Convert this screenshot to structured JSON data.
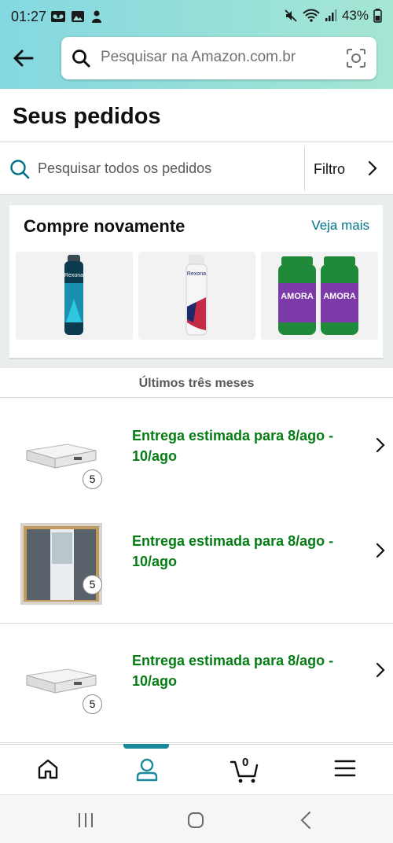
{
  "status_bar": {
    "time": "01:27",
    "battery_percent": "43%",
    "left_icons": [
      "voicemail-icon",
      "gallery-icon",
      "android-icon"
    ],
    "right_icons": [
      "mute-icon",
      "wifi-icon",
      "signal-icon",
      "battery-icon"
    ]
  },
  "header": {
    "search_placeholder": "Pesquisar na Amazon.com.br"
  },
  "page": {
    "title": "Seus pedidos"
  },
  "orders_search": {
    "placeholder": "Pesquisar todos os pedidos",
    "filter_label": "Filtro"
  },
  "buy_again": {
    "title": "Compre novamente",
    "see_more": "Veja mais",
    "items": [
      {
        "name": "rexona-men-deodorant"
      },
      {
        "name": "rexona-women-deodorant"
      },
      {
        "name": "amora-miura-supplement"
      }
    ]
  },
  "orders": {
    "section_label": "Últimos três meses",
    "items": [
      {
        "status": "Entrega estimada para 8/ago - 10/ago",
        "quantity": "5",
        "product": "mattress"
      },
      {
        "status": "Entrega estimada para 8/ago - 10/ago",
        "quantity": "5",
        "product": "wardrobe"
      },
      {
        "status": "Entrega estimada para 8/ago - 10/ago",
        "quantity": "5",
        "product": "mattress"
      }
    ]
  },
  "bottom_nav": {
    "items": [
      "home-icon",
      "account-icon",
      "cart-icon",
      "menu-icon"
    ],
    "active": "account-icon",
    "cart_count": "0"
  },
  "colors": {
    "header_gradient_start": "#84d8e1",
    "header_gradient_end": "#a5e6d3",
    "link": "#007185",
    "delivery_green": "#067d14",
    "active_tab": "#1a8a9a"
  }
}
